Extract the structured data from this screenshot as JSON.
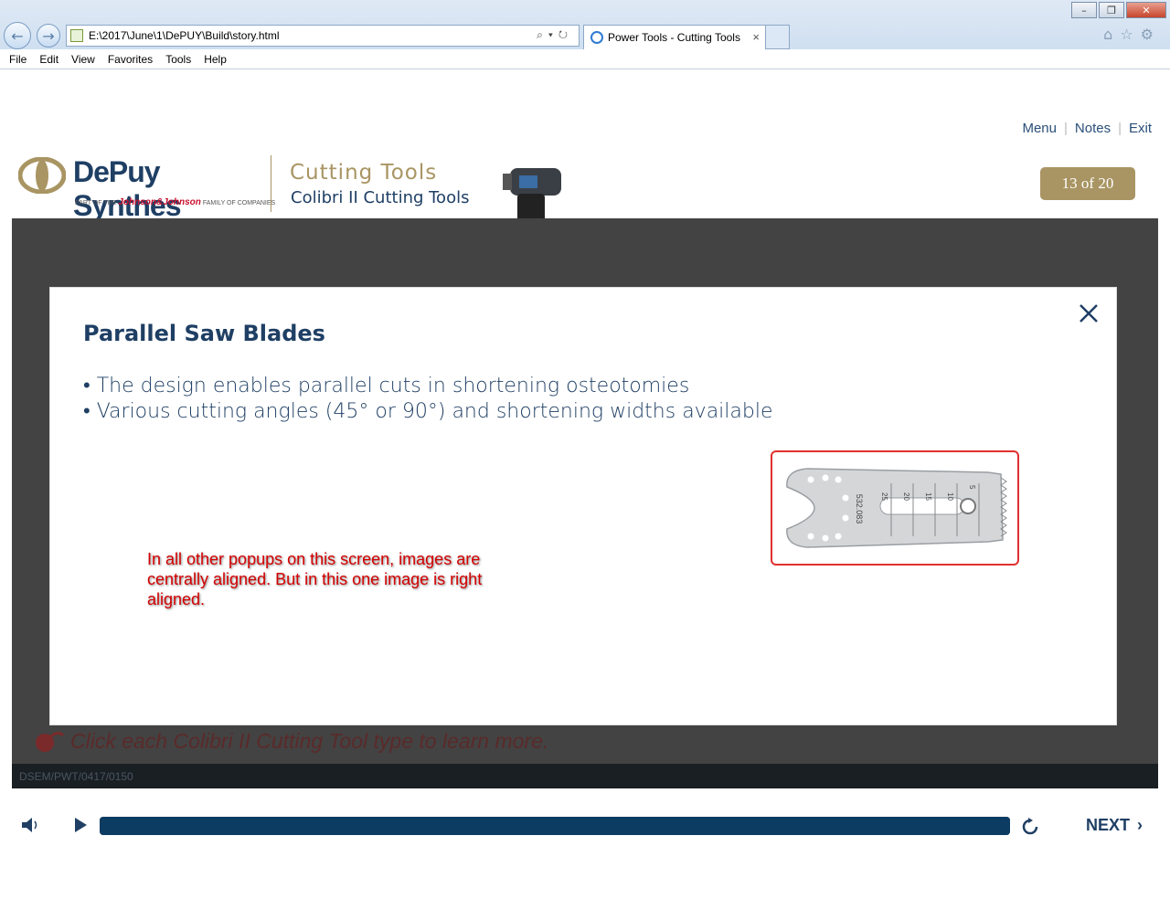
{
  "browser": {
    "address": "E:\\2017\\June\\1\\DePUY\\Build\\story.html",
    "tab_title": "Power Tools - Cutting Tools",
    "tab_close": "×",
    "menu": [
      "File",
      "Edit",
      "View",
      "Favorites",
      "Tools",
      "Help"
    ]
  },
  "header": {
    "links": [
      "Menu",
      "Notes",
      "Exit"
    ],
    "logo_text": "DePuy Synthes",
    "logo_sub_prefix": "PART OF THE",
    "logo_sub_brand": "Johnson&Johnson",
    "logo_sub_suffix": "FAMILY OF COMPANIES",
    "course_title": "Cutting Tools",
    "course_subtitle": "Colibri II Cutting Tools",
    "page_counter": "13 of 20"
  },
  "popup": {
    "title": "Parallel Saw Blades",
    "bullets": [
      "• The design enables parallel cuts in shortening osteotomies",
      "• Various cutting angles (45° or 90°) and shortening widths available"
    ],
    "blade_label": "532.083",
    "blade_scale": [
      "25",
      "20",
      "15",
      "10",
      "5"
    ]
  },
  "annotation": "In all other popups on this screen, images are centrally aligned. But in this one image is right aligned.",
  "slide": {
    "instruction": "Click each Colibri II Cutting Tool type to learn more.",
    "footer_code": "DSEM/PWT/0417/0150"
  },
  "player": {
    "progress": 1.0,
    "next_label": "NEXT"
  },
  "colors": {
    "brand_navy": "#1f3f64",
    "brand_gold": "#a99563",
    "annotation_red": "#d40000"
  }
}
